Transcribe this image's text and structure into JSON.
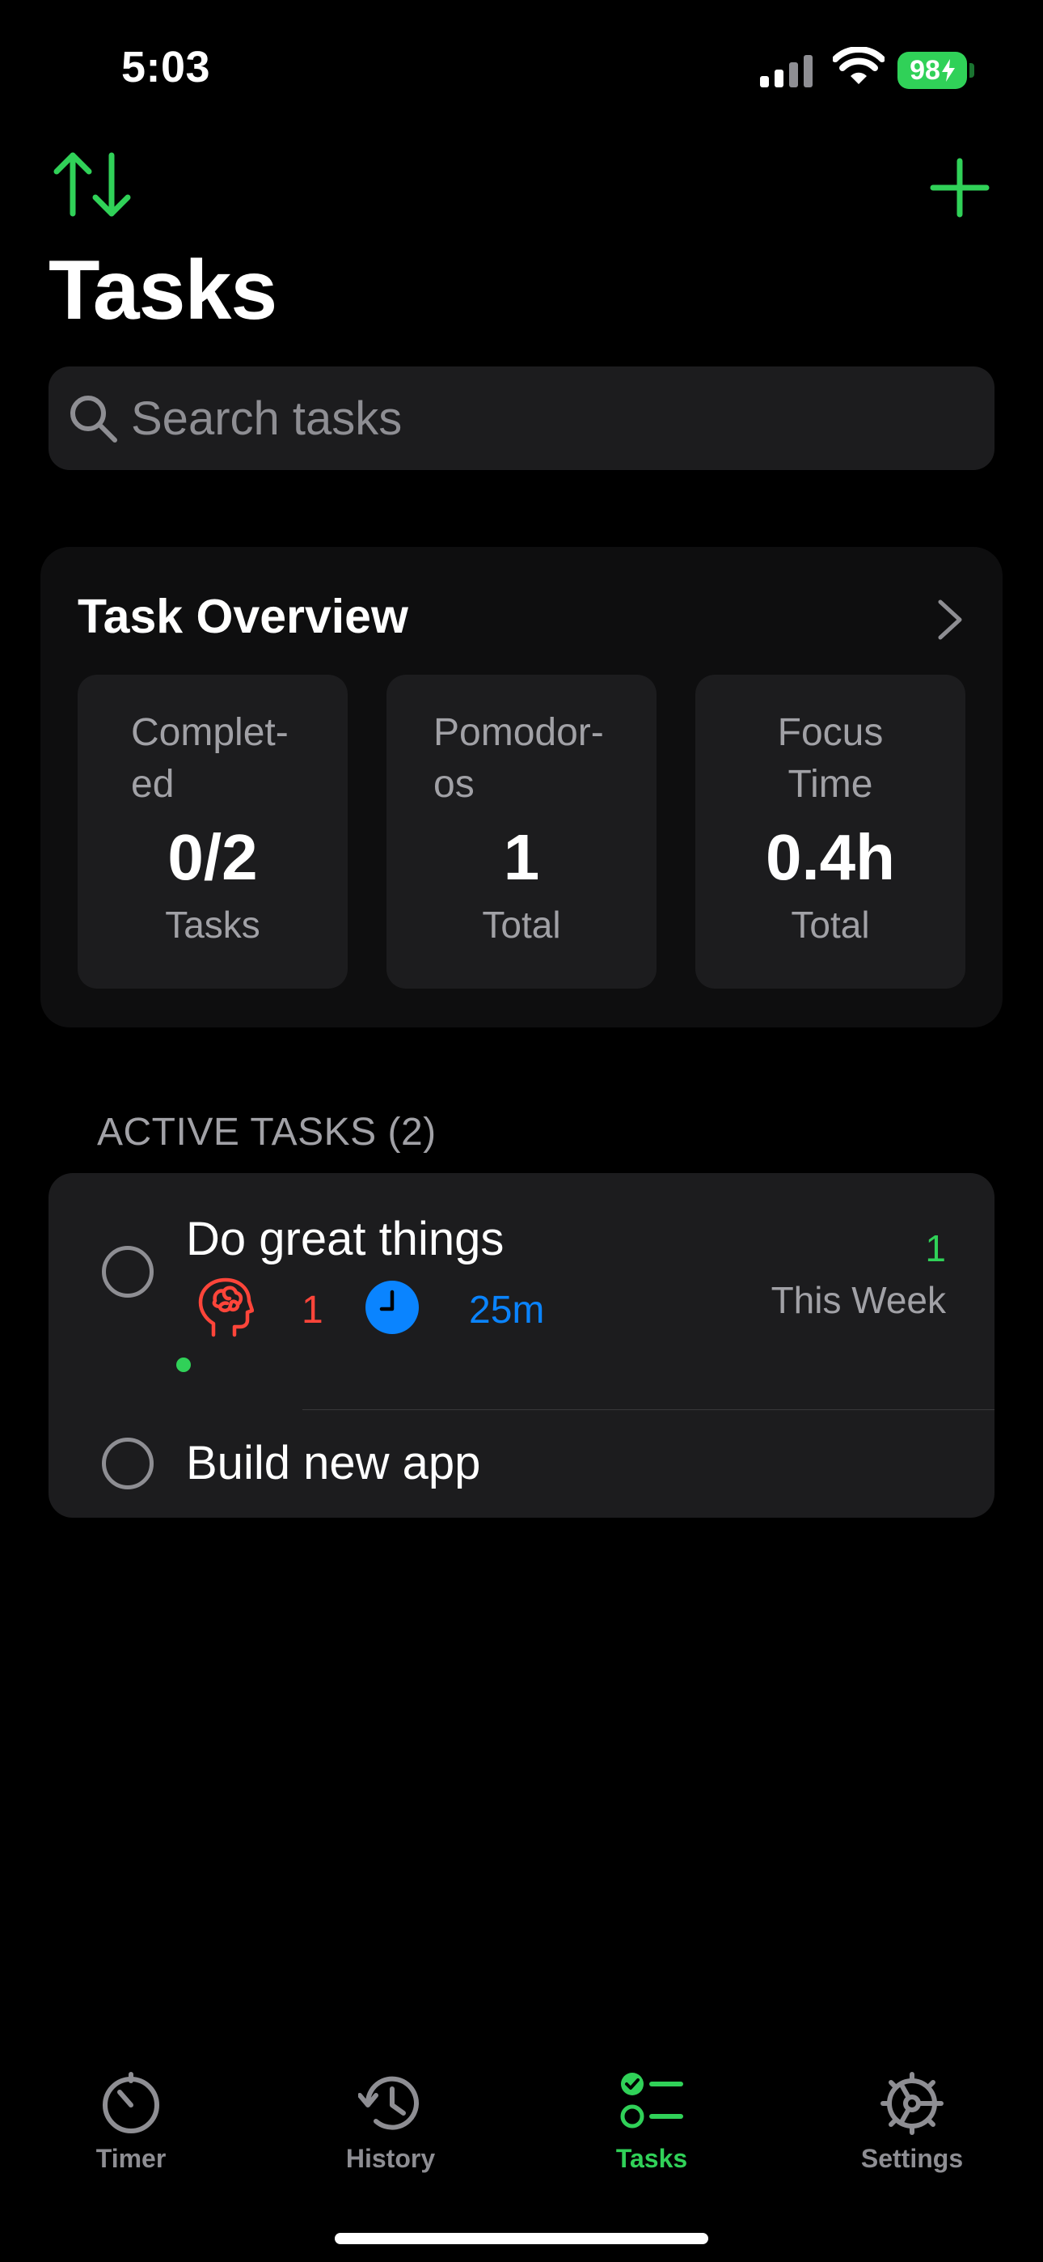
{
  "status_bar": {
    "time": "5:03",
    "battery": "98"
  },
  "header": {
    "sort_icon": "sort-arrows-icon",
    "add_icon": "plus-icon",
    "title": "Tasks"
  },
  "search": {
    "placeholder": "Search tasks"
  },
  "overview": {
    "title": "Task Overview",
    "stats": [
      {
        "label": "Complet-ed",
        "label_lines": [
          "Complet-",
          "ed"
        ],
        "value": "0/2",
        "sub": "Tasks"
      },
      {
        "label": "Pomodor-os",
        "label_lines": [
          "Pomodor-",
          "os"
        ],
        "value": "1",
        "sub": "Total"
      },
      {
        "label": "Focus Time",
        "label_lines": [
          "Focus",
          "Time"
        ],
        "value": "0.4h",
        "sub": "Total"
      }
    ]
  },
  "active_tasks": {
    "header": "ACTIVE TASKS (2)",
    "items": [
      {
        "title": "Do great things",
        "pomodoros": "1",
        "duration": "25m",
        "week_count": "1",
        "week_label": "This Week",
        "active": true
      },
      {
        "title": "Build new app"
      }
    ]
  },
  "tab_bar": {
    "tabs": [
      {
        "label": "Timer",
        "icon": "timer-icon",
        "active": false
      },
      {
        "label": "History",
        "icon": "history-icon",
        "active": false
      },
      {
        "label": "Tasks",
        "icon": "tasks-icon",
        "active": true
      },
      {
        "label": "Settings",
        "icon": "settings-icon",
        "active": false
      }
    ]
  },
  "colors": {
    "accent": "#30d158",
    "red": "#ff453a",
    "blue": "#0a84ff",
    "card": "#1c1c1e",
    "background": "#000000"
  }
}
